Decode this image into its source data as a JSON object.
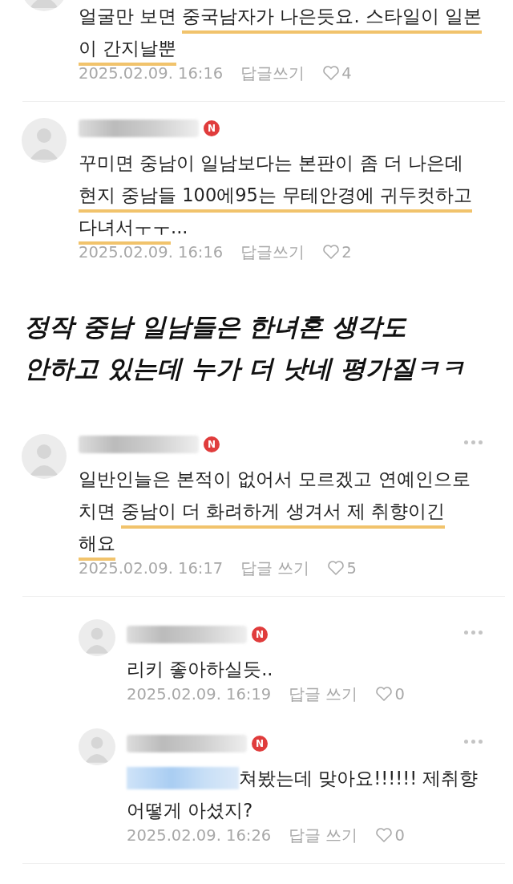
{
  "thread_top": [
    {
      "kind": "comment",
      "author_redacted": false,
      "menu": false,
      "lines": [
        [
          {
            "kind": "text",
            "text": "얼굴만 보면 ",
            "underlined": false
          },
          {
            "kind": "text",
            "text": "중국남자가 나은듯요. 스타일이 일본",
            "underlined": true
          }
        ],
        [
          {
            "kind": "text",
            "text": "이 간지날뿐",
            "underlined": true
          }
        ]
      ],
      "date": "2025.02.09. 16:16",
      "reply": "답글쓰기",
      "likes": "4",
      "divider": true
    },
    {
      "kind": "comment",
      "author_redacted": true,
      "badge": "N",
      "menu": false,
      "lines": [
        [
          {
            "kind": "text",
            "text": "꾸미면 중남이 일남보다는 본판이 좀 더 나은데",
            "underlined": false
          }
        ],
        [
          {
            "kind": "text",
            "text": "현지 중남들 100에95는 무테안경에 귀두컷하고",
            "underlined": true
          }
        ],
        [
          {
            "kind": "text",
            "text": "다녀서ㅜㅜ",
            "underlined": true
          },
          {
            "kind": "text",
            "text": "...",
            "underlined": false
          }
        ]
      ],
      "date": "2025.02.09. 16:16",
      "reply": "답글쓰기",
      "likes": "2",
      "divider": false
    }
  ],
  "caption": [
    "정작 중남 일남들은 한녀혼 생각도",
    "안하고 있는데 누가 더 낫네 평가질ㅋㅋ"
  ],
  "thread_bottom": [
    {
      "kind": "comment",
      "author_redacted": true,
      "badge": "N",
      "menu": true,
      "lines": [
        [
          {
            "kind": "text",
            "text": "일반인늘은 본적이 없어서 모르겠고 연예인으로",
            "underlined": false
          }
        ],
        [
          {
            "kind": "text",
            "text": "치면 ",
            "underlined": false
          },
          {
            "kind": "text",
            "text": "중남이 더 화려하게 생겨서 제 취향이긴",
            "underlined": true
          }
        ],
        [
          {
            "kind": "text",
            "text": "해요",
            "underlined": true
          }
        ]
      ],
      "date": "2025.02.09. 16:17",
      "reply": "답글 쓰기",
      "likes": "5",
      "divider": true
    },
    {
      "kind": "reply",
      "author_redacted": true,
      "badge": "N",
      "menu": true,
      "lines": [
        [
          {
            "kind": "text",
            "text": "리키 좋아하실듯..",
            "underlined": false
          }
        ]
      ],
      "date": "2025.02.09. 16:19",
      "reply": "답글 쓰기",
      "likes": "0",
      "divider": false
    },
    {
      "kind": "reply",
      "author_redacted": true,
      "badge": "N",
      "menu": true,
      "lines": [
        [
          {
            "kind": "redacted"
          },
          {
            "kind": "text",
            "text": "쳐봤는데 맞아요!!!!!! 제취향",
            "underlined": false
          }
        ],
        [
          {
            "kind": "text",
            "text": "어떻게 아셨지?",
            "underlined": false
          }
        ]
      ],
      "date": "2025.02.09. 16:26",
      "reply": "답글 쓰기",
      "likes": "0",
      "divider": true
    }
  ]
}
